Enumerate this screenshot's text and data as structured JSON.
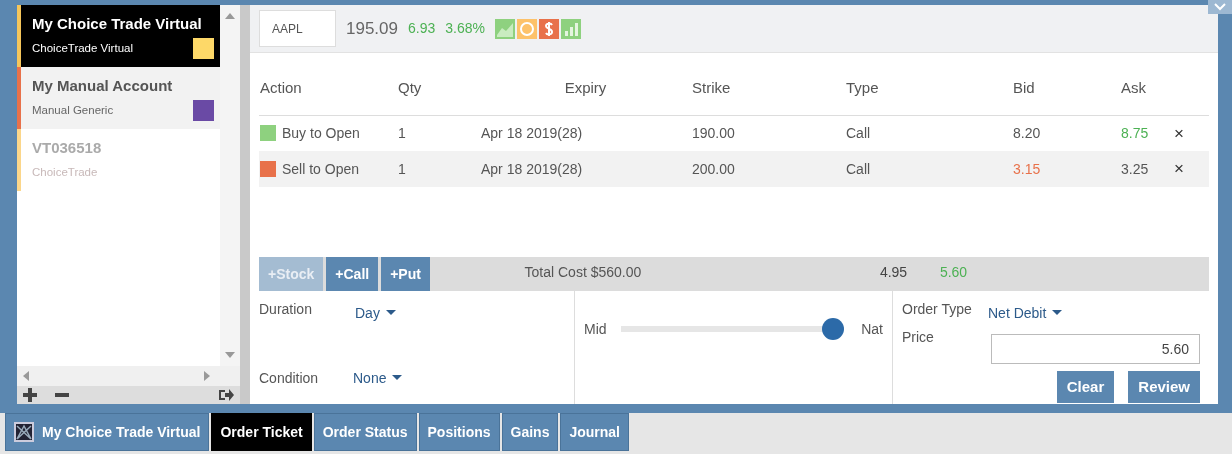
{
  "accounts": [
    {
      "name": "My Choice Trade Virtual",
      "type": "ChoiceTrade Virtual",
      "selected": true,
      "disabled": false,
      "swatch": {
        "color": "#fdd868"
      },
      "stripe": {
        "color": "#f6c65b"
      }
    },
    {
      "name": "My Manual Account",
      "type": "Manual Generic",
      "selected": false,
      "disabled": false,
      "swatch": {
        "color": "#6a4aa5"
      },
      "stripe": {
        "color": "#e8714a"
      }
    },
    {
      "name": "VT036518",
      "type": "ChoiceTrade",
      "selected": false,
      "disabled": true,
      "stripe": {
        "color": "#fbd68a"
      }
    }
  ],
  "quote": {
    "symbol": "AAPL",
    "price": "195.09",
    "change": "6.93",
    "change_pct": "3.68%"
  },
  "legs_table": {
    "columns": [
      "Action",
      "Qty",
      "Expiry",
      "Strike",
      "Type",
      "Bid",
      "Ask"
    ],
    "rows": [
      {
        "action": "Buy to Open",
        "kind": "buy",
        "color": "#8ed17f",
        "qty": "1",
        "expiry": "Apr 18 2019(28)",
        "strike": "190.00",
        "type": "Call",
        "bid": "8.20",
        "ask": "8.75",
        "remove": "×"
      },
      {
        "action": "Sell to Open",
        "kind": "sell",
        "color": "#e8714a",
        "qty": "1",
        "expiry": "Apr 18 2019(28)",
        "strike": "200.00",
        "type": "Call",
        "bid": "3.15",
        "ask": "3.25",
        "remove": "×"
      }
    ]
  },
  "add_buttons": [
    {
      "label": "+Stock",
      "disabled": true
    },
    {
      "label": "+Call",
      "disabled": false
    },
    {
      "label": "+Put",
      "disabled": false
    }
  ],
  "total_cost": "Total Cost $560.00",
  "total_bid": "4.95",
  "total_ask": "5.60",
  "duration": {
    "label": "Duration",
    "value": "Day"
  },
  "condition": {
    "label": "Condition",
    "value": "None"
  },
  "price_slider": {
    "left": "Mid",
    "right": "Nat",
    "level": 1
  },
  "order_type": {
    "label": "Order Type",
    "value": "Net Debit"
  },
  "price": {
    "label": "Price",
    "value": "5.60"
  },
  "actions": [
    "Clear",
    "Review"
  ],
  "bottom_tabs": [
    {
      "label": "My Choice Trade Virtual",
      "kind": "account",
      "selected": false
    },
    {
      "label": "Order Ticket",
      "kind": "tab",
      "selected": true
    },
    {
      "label": "Order Status",
      "kind": "tab",
      "selected": false
    },
    {
      "label": "Positions",
      "kind": "tab",
      "selected": false
    },
    {
      "label": "Gains",
      "kind": "tab",
      "selected": false
    },
    {
      "label": "Journal",
      "kind": "tab",
      "selected": false
    }
  ]
}
